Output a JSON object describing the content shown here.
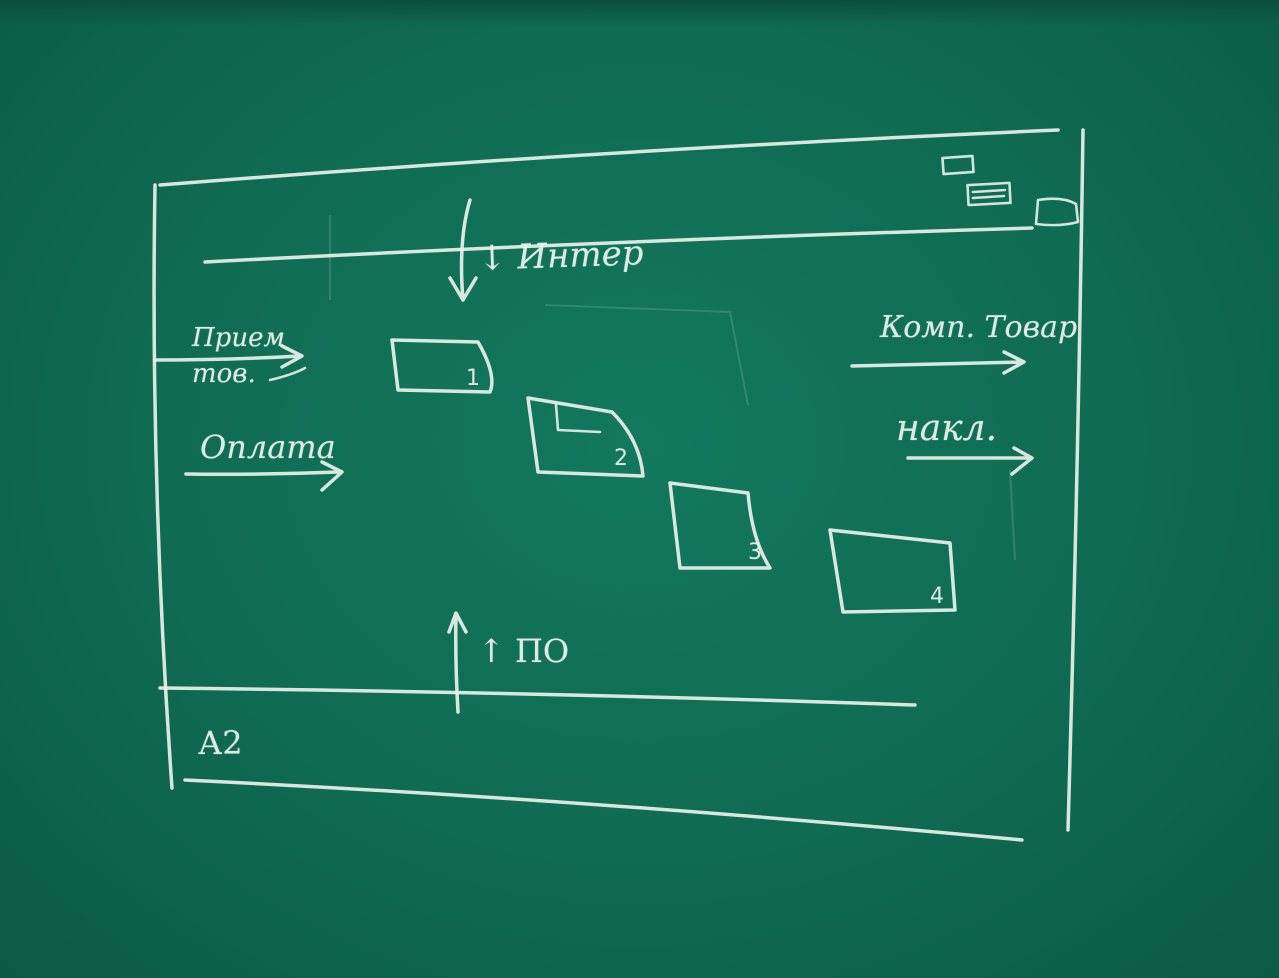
{
  "labels": {
    "interface": "↓ Интер",
    "left_top": "Прием тов.",
    "left_bottom": "Оплата",
    "right_top": "Комп. Товар",
    "right_bottom": "накл.",
    "bottom": "↑ ПО",
    "footer": "А2"
  },
  "windows": [
    {
      "number": "1"
    },
    {
      "number": "2"
    },
    {
      "number": "3"
    },
    {
      "number": "4"
    }
  ],
  "chalk_color": "#e9f1ec",
  "board_color": "#0f6a52"
}
